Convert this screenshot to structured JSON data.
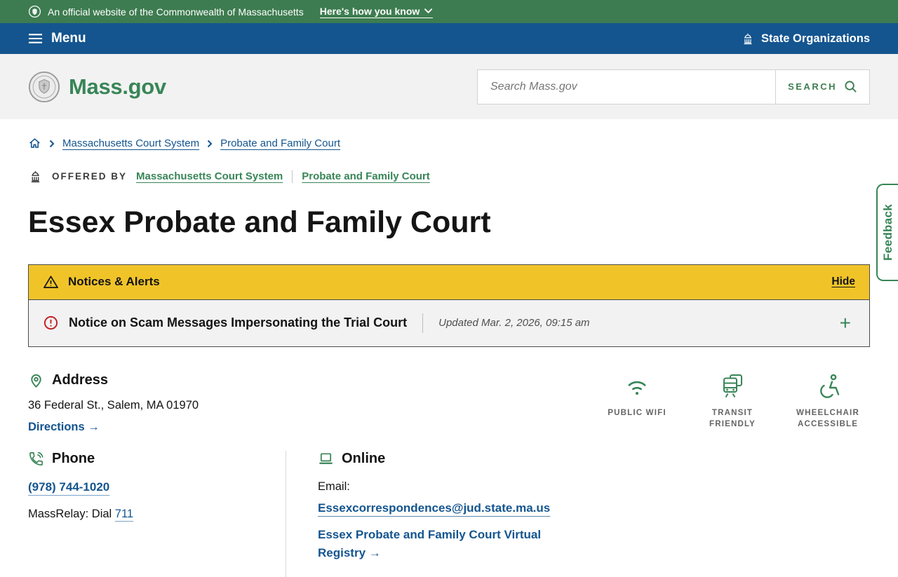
{
  "banner": {
    "official_text": "An official website of the Commonwealth of Massachusetts",
    "how_you_know_label": "Here's how you know"
  },
  "nav": {
    "menu_label": "Menu",
    "state_orgs_label": "State Organizations"
  },
  "header": {
    "logo_text": "Mass.gov",
    "search_placeholder": "Search Mass.gov",
    "search_button_label": "SEARCH"
  },
  "breadcrumb": {
    "items": [
      "Massachusetts Court System",
      "Probate and Family Court"
    ]
  },
  "offered_by": {
    "label": "OFFERED BY",
    "links": [
      "Massachusetts Court System",
      "Probate and Family Court"
    ]
  },
  "page": {
    "title": "Essex Probate and Family Court"
  },
  "alerts": {
    "header_title": "Notices & Alerts",
    "hide_label": "Hide",
    "notice_title": "Notice on Scam Messages Impersonating the Trial Court",
    "updated_text": "Updated Mar. 2, 2026, 09:15 am",
    "expand_label": "+"
  },
  "address": {
    "heading": "Address",
    "street": "36 Federal St., Salem, MA 01970",
    "directions_label": "Directions →"
  },
  "amenities": [
    {
      "label": "PUBLIC WIFI",
      "icon": "wifi-icon"
    },
    {
      "label": "TRANSIT FRIENDLY",
      "icon": "transit-icon"
    },
    {
      "label": "WHEELCHAIR ACCESSIBLE",
      "icon": "wheelchair-icon"
    }
  ],
  "phone": {
    "heading": "Phone",
    "number": "(978) 744-1020",
    "massrelay_prefix": "MassRelay: Dial",
    "massrelay_link": "711"
  },
  "online": {
    "heading": "Online",
    "email_label": "Email:",
    "email_link": "Essexcorrespondences@jud.state.ma.us",
    "registry_link": "Essex Probate and Family Court Virtual Registry →"
  },
  "feedback": {
    "label": "Feedback"
  },
  "colors": {
    "banner_green": "#3D7C50",
    "nav_blue": "#14558F",
    "brand_green": "#388557",
    "link_blue": "#14558F",
    "alert_yellow": "#F0C429",
    "alert_red": "#C21D25",
    "header_gray": "#F2F2F2",
    "text_dark": "#141414"
  }
}
